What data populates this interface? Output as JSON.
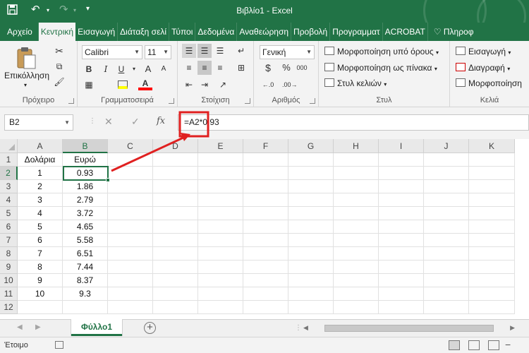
{
  "window": {
    "title": "Βιβλίο1 - Excel"
  },
  "menu": {
    "file": "Αρχείο",
    "tabs": [
      "Κεντρική",
      "Εισαγωγή",
      "Διάταξη σελί",
      "Τύποι",
      "Δεδομένα",
      "Αναθεώρηση",
      "Προβολή",
      "Προγραμματ",
      "ACROBAT"
    ],
    "active_tab": "Κεντρική",
    "help": "Πληροφ"
  },
  "ribbon": {
    "clipboard": {
      "paste_label": "Επικόλληση",
      "group_label": "Πρόχειρο"
    },
    "font": {
      "name": "Calibri",
      "size": "11",
      "bold": "B",
      "italic": "I",
      "underline": "U",
      "grow": "A",
      "shrink": "A",
      "group_label": "Γραμματοσειρά",
      "highlight_color": "#ffff00",
      "font_color": "#ff0000"
    },
    "alignment": {
      "group_label": "Στοίχιση"
    },
    "number": {
      "format": "Γενική",
      "currency": "$",
      "percent": "%",
      "comma": "000",
      "group_label": "Αριθμός"
    },
    "styles": {
      "conditional": "Μορφοποίηση υπό όρους",
      "as_table": "Μορφοποίηση ως πίνακα",
      "cell_styles": "Στυλ κελιών",
      "group_label": "Στυλ"
    },
    "cells": {
      "insert": "Εισαγωγή",
      "delete": "Διαγραφή",
      "format": "Μορφοποίηση",
      "group_label": "Κελιά"
    }
  },
  "formula_bar": {
    "name_box": "B2",
    "formula": "=A2*0.93",
    "fx": "fx"
  },
  "grid": {
    "columns": [
      "A",
      "B",
      "C",
      "D",
      "E",
      "F",
      "G",
      "H",
      "I",
      "J",
      "K"
    ],
    "rows": [
      "1",
      "2",
      "3",
      "4",
      "5",
      "6",
      "7",
      "8",
      "9",
      "10",
      "11",
      "12"
    ],
    "selected_cell": "B2",
    "cells": [
      [
        "Δολάρια",
        "Ευρώ"
      ],
      [
        "1",
        "0.93"
      ],
      [
        "2",
        "1.86"
      ],
      [
        "3",
        "2.79"
      ],
      [
        "4",
        "3.72"
      ],
      [
        "5",
        "4.65"
      ],
      [
        "6",
        "5.58"
      ],
      [
        "7",
        "6.51"
      ],
      [
        "8",
        "7.44"
      ],
      [
        "9",
        "8.37"
      ],
      [
        "10",
        "9.3"
      ],
      [
        "",
        ""
      ]
    ]
  },
  "sheets": {
    "active": "Φύλλο1",
    "add": "+"
  },
  "status": {
    "ready": "Έτοιμο"
  },
  "colors": {
    "brand": "#217346",
    "annotation": "#e02020"
  }
}
